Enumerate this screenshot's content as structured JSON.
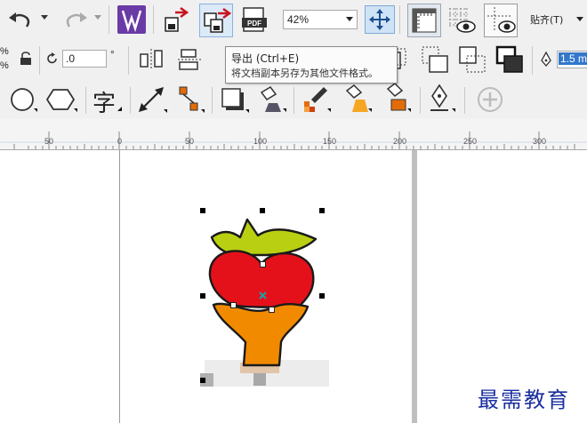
{
  "toolbar1": {
    "zoom_value": "42%",
    "snap_label": "贴齐(T)"
  },
  "toolbar2": {
    "rotation_value": ".0",
    "degree_symbol": "°",
    "outline_width": "1.5 m",
    "percent_symbols": "%"
  },
  "toolbar3": {
    "text_tool_glyph": "字"
  },
  "tooltip": {
    "title": "导出 (Ctrl+E)",
    "description": "将文档副本另存为其他文件格式。"
  },
  "ruler": {
    "labels": [
      "50",
      "0",
      "50",
      "100",
      "150",
      "200",
      "250",
      "300"
    ]
  },
  "watermark": "最需教育",
  "colors": {
    "crown": "#b9cf12",
    "heart": "#e4111b",
    "body": "#f28a00",
    "toolbar": "#f0f0f0",
    "accent": "#1a2fa0"
  }
}
